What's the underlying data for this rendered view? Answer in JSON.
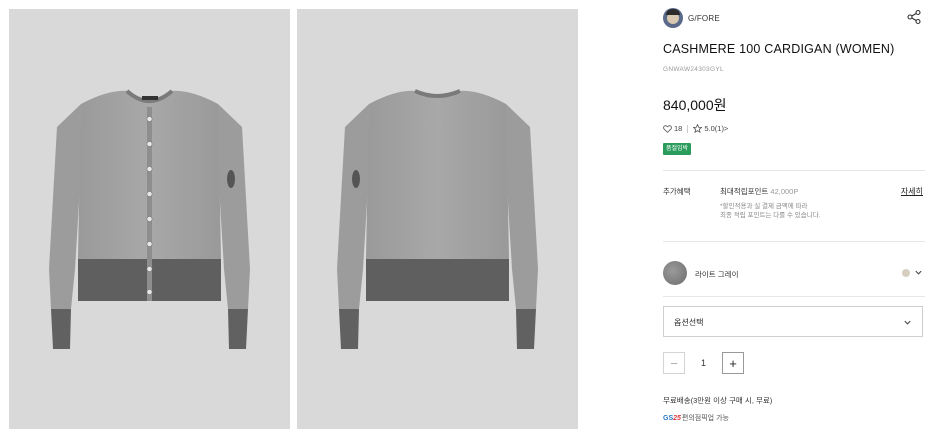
{
  "product": {
    "brand": "G/FORE",
    "title": "CASHMERE 100 CARDIGAN (WOMEN)",
    "code": "GNWAW24303GYL",
    "price": "840,000원",
    "likes": "18",
    "rating": "5.0(1)>",
    "badge": "품절임박"
  },
  "benefit": {
    "label": "추가혜택",
    "title": "최대적립포인트",
    "points": "42,000P",
    "link": "자세히",
    "note_line1": "*할인적용과 실 결제 금액에 따라",
    "note_line2": "최종 적립 포인트는 다를 수 있습니다."
  },
  "color": {
    "name": "라이트 그레이",
    "swatch_color": "#7a7a7a",
    "dot_color": "#d6cfc0"
  },
  "option": {
    "placeholder": "옵션선택"
  },
  "quantity": {
    "minus": "−",
    "value": "1",
    "plus": "+"
  },
  "shipping": {
    "text": "무료배송(3만원 이상 구매 시, 무료)",
    "pickup_brand": "GS",
    "pickup_brand_num": "25",
    "pickup_text": "편의점픽업 가능"
  },
  "icons": {
    "share": "share-icon",
    "heart": "heart-icon",
    "star": "star-icon",
    "chevron": "chevron-down-icon"
  },
  "colors": {
    "background_panel": "#d9d9d9",
    "badge": "#2a9c5c",
    "sweater_light": "#a3a3a3",
    "sweater_dark": "#5f5f5f"
  }
}
